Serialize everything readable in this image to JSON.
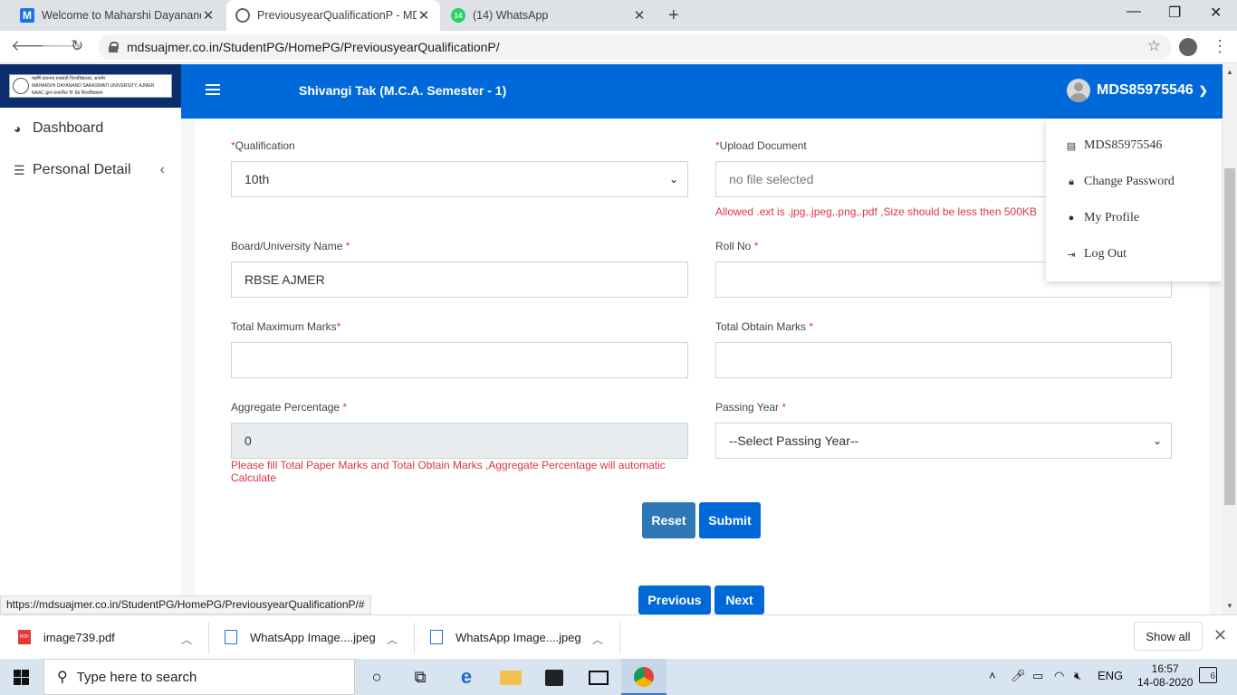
{
  "browser": {
    "tabs": [
      {
        "title": "Welcome to Maharshi Dayanand",
        "active": false
      },
      {
        "title": "PreviousyearQualificationP - MD",
        "active": true
      },
      {
        "title": "(14) WhatsApp",
        "active": false,
        "badge": "14"
      }
    ],
    "url": "mdsuajmer.co.in/StudentPG/HomePG/PreviousyearQualificationP/",
    "status_url": "https://mdsuajmer.co.in/StudentPG/HomePG/PreviousyearQualificationP/#",
    "tab_close_glyph": "✕",
    "newtab_glyph": "+",
    "window_controls": {
      "minimize": "—",
      "maximize": "❐",
      "close": "✕"
    }
  },
  "sidebar": {
    "logo_text_line1": "महर्षि दयानन्द सरस्वती विश्वविद्यालय, अजमेर",
    "logo_text_line2": "MAHARSHI DAYANAND SARASWATI UNIVERSITY, AJMER",
    "logo_text_line3": "NAAC द्वारा प्रत्यायित 'B' ग्रेड विश्वविद्यालय",
    "items": [
      {
        "label": "Dashboard",
        "icon": "tachometer-icon"
      },
      {
        "label": "Personal Detail",
        "icon": "list-icon"
      }
    ]
  },
  "header": {
    "student": "Shivangi Tak  (M.C.A. Semester - 1)",
    "user_id": "MDS85975546"
  },
  "user_dropdown": {
    "items": [
      {
        "label": "MDS85975546",
        "icon": "id-card-icon"
      },
      {
        "label": "Change Password",
        "icon": "lock-icon"
      },
      {
        "label": "My Profile",
        "icon": "user-icon"
      },
      {
        "label": "Log Out",
        "icon": "sign-out-icon"
      }
    ]
  },
  "form": {
    "qualification": {
      "label": "Qualification",
      "required": "*",
      "value": "10th"
    },
    "upload": {
      "label": "Upload Document",
      "required": "*",
      "placeholder": "no file selected",
      "hint": "Allowed .ext is .jpg,.jpeg,.png,.pdf ,Size should be less then 500KB"
    },
    "board": {
      "label": "Board/University Name ",
      "required": "*",
      "value": "RBSE AJMER"
    },
    "roll": {
      "label": "Roll No ",
      "required": "*",
      "value": ""
    },
    "max_marks": {
      "label": "Total Maximum Marks",
      "required": "*",
      "value": ""
    },
    "obtain_marks": {
      "label": "Total Obtain Marks ",
      "required": "*",
      "value": ""
    },
    "aggregate": {
      "label": "Aggregate Percentage ",
      "required": "*",
      "value": "0",
      "hint": "Please fill Total Paper Marks and Total Obtain Marks ,Aggregate Percentage will automatic Calculate"
    },
    "passing_year": {
      "label": "Passing Year ",
      "required": "*",
      "value": "--Select Passing Year--"
    },
    "reset_label": "Reset",
    "submit_label": "Submit",
    "previous_label": "Previous",
    "next_label": "Next"
  },
  "downloads": {
    "items": [
      {
        "name": "image739.pdf",
        "type": "pdf-icon"
      },
      {
        "name": "WhatsApp Image....jpeg",
        "type": "image-file-icon"
      },
      {
        "name": "WhatsApp Image....jpeg",
        "type": "image-file-icon"
      }
    ],
    "show_all": "Show all"
  },
  "taskbar": {
    "search_placeholder": "Type here to search",
    "lang": "ENG",
    "time": "16:57",
    "date": "14-08-2020",
    "notifications": "6"
  }
}
